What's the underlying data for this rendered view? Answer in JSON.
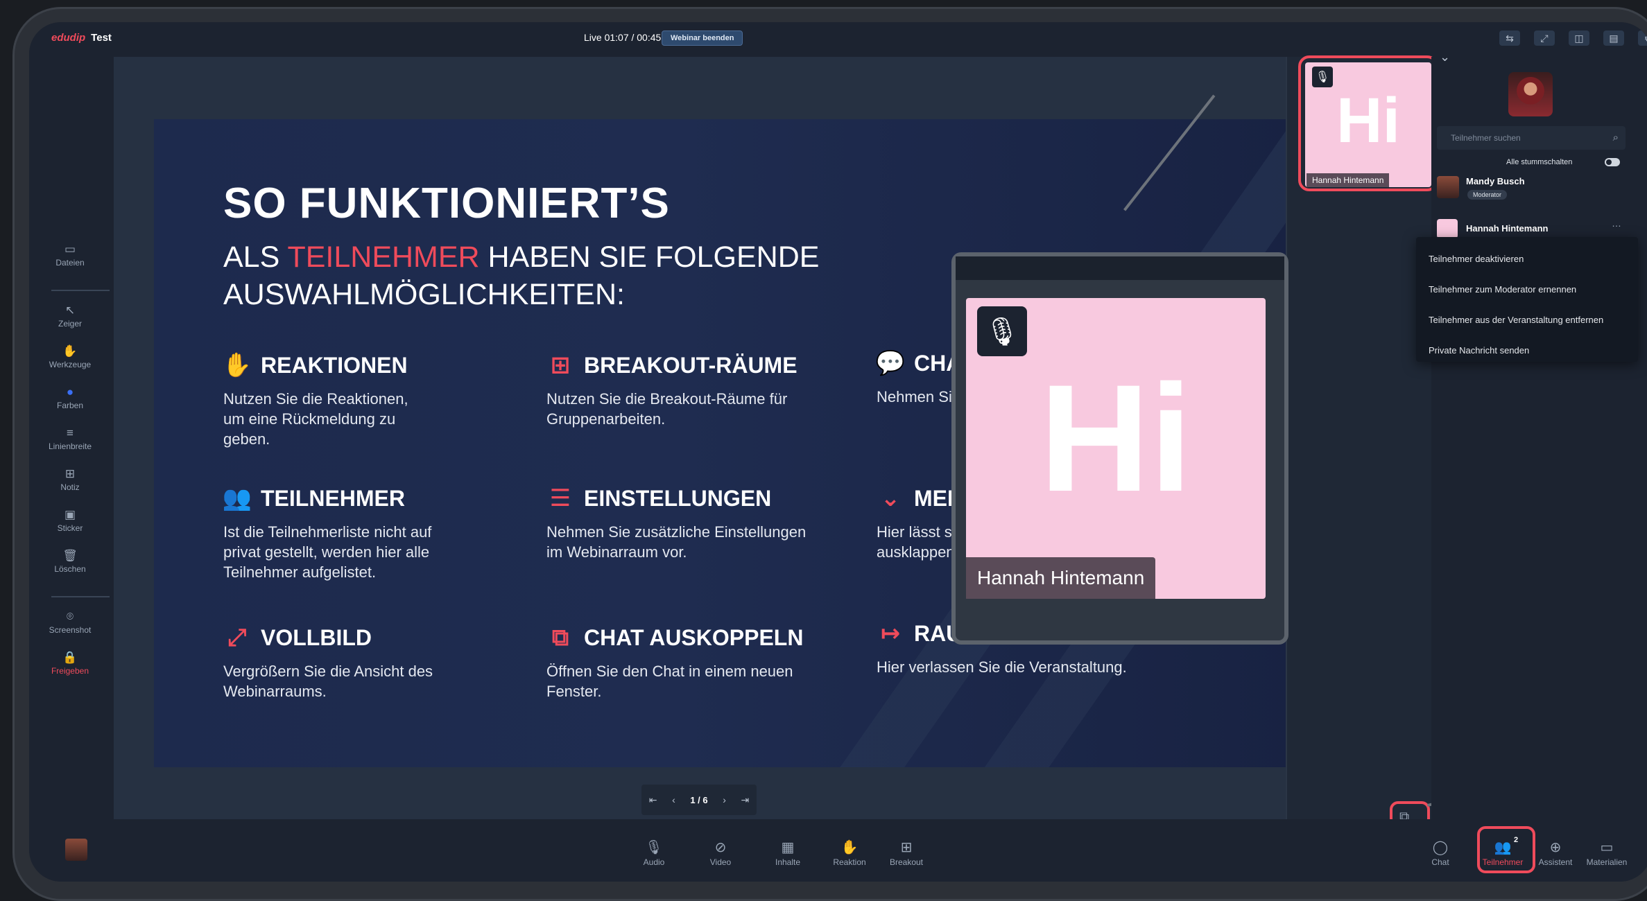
{
  "topbar": {
    "logo": "edudip",
    "event_name": "Test",
    "live_status": "Live  01:07 / 00:45",
    "end_button": "Webinar beenden",
    "icons": [
      "reactions-icon",
      "fullscreen-icon",
      "layout-icon",
      "chat-popout-icon",
      "settings-icon"
    ]
  },
  "left_tools": {
    "files": "Dateien",
    "pointer": "Zeiger",
    "tools": "Werkzeuge",
    "colors": "Farben",
    "line_width": "Linienbreite",
    "note": "Notiz",
    "sticker": "Sticker",
    "delete": "Löschen",
    "screenshot": "Screenshot",
    "share": "Freigeben"
  },
  "slide": {
    "title": "SO FUNKTIONIERT’S",
    "subtitle_pre": "ALS ",
    "subtitle_highlight": "TEILNEHMER",
    "subtitle_post": " HABEN SIE FOLGENDE AUSWAHLMÖGLICHKEITEN:",
    "features": [
      {
        "title": "REAKTIONEN",
        "desc": "Nutzen Sie die Reaktionen, um eine Rückmeldung zu geben."
      },
      {
        "title": "BREAKOUT-RÄUME",
        "desc": "Nutzen Sie die Breakout-Räume für Gruppenarbeiten."
      },
      {
        "title": "CHAT",
        "desc": "Nehmen Sie ar"
      },
      {
        "title": "TEILNEHMER",
        "desc": "Ist die Teilnehmerliste nicht auf privat gestellt, werden hier alle Teilnehmer aufgelistet."
      },
      {
        "title": "EINSTELLUNGEN",
        "desc": "Nehmen Sie zusätzliche Einstellungen im Webinarraum vor."
      },
      {
        "title": "MENÜ",
        "desc": "Hier lässt sich ausklappen."
      },
      {
        "title": "VOLLBILD",
        "desc": "Vergrößern Sie die Ansicht des Webinarraums."
      },
      {
        "title": "CHAT AUSKOPPELN",
        "desc": "Öffnen Sie den Chat in einem neuen Fenster."
      },
      {
        "title": "RAUM",
        "desc": "Hier verlassen Sie die Veranstaltung."
      }
    ]
  },
  "pager": {
    "page": "1 / 6"
  },
  "video_tile": {
    "initials": "Hi",
    "name": "Hannah Hintemann"
  },
  "zoom_tile": {
    "initials": "Hi",
    "name": "Hannah Hintemann"
  },
  "participants": {
    "search_placeholder": "Teilnehmer suchen",
    "mute_all": "Alle stummschalten",
    "list": [
      {
        "name": "Mandy Busch",
        "role": "Moderator"
      },
      {
        "name": "Hannah Hintemann",
        "role": ""
      }
    ],
    "context_menu": [
      "Teilnehmer deaktivieren",
      "Teilnehmer zum Moderator ernennen",
      "Teilnehmer aus der Veranstaltung entfernen",
      "Private Nachricht senden"
    ]
  },
  "bottombar": {
    "audio": "Audio",
    "video": "Video",
    "content": "Inhalte",
    "reaction": "Reaktion",
    "breakout": "Breakout",
    "chat": "Chat",
    "participants": "Teilnehmer",
    "participants_count": "2",
    "assistant": "Assistent",
    "materials": "Materialien"
  },
  "colors": {
    "accent": "#ef4b5b",
    "slide_bg": "#1f2c50",
    "tile_pink": "#f8c9df"
  }
}
